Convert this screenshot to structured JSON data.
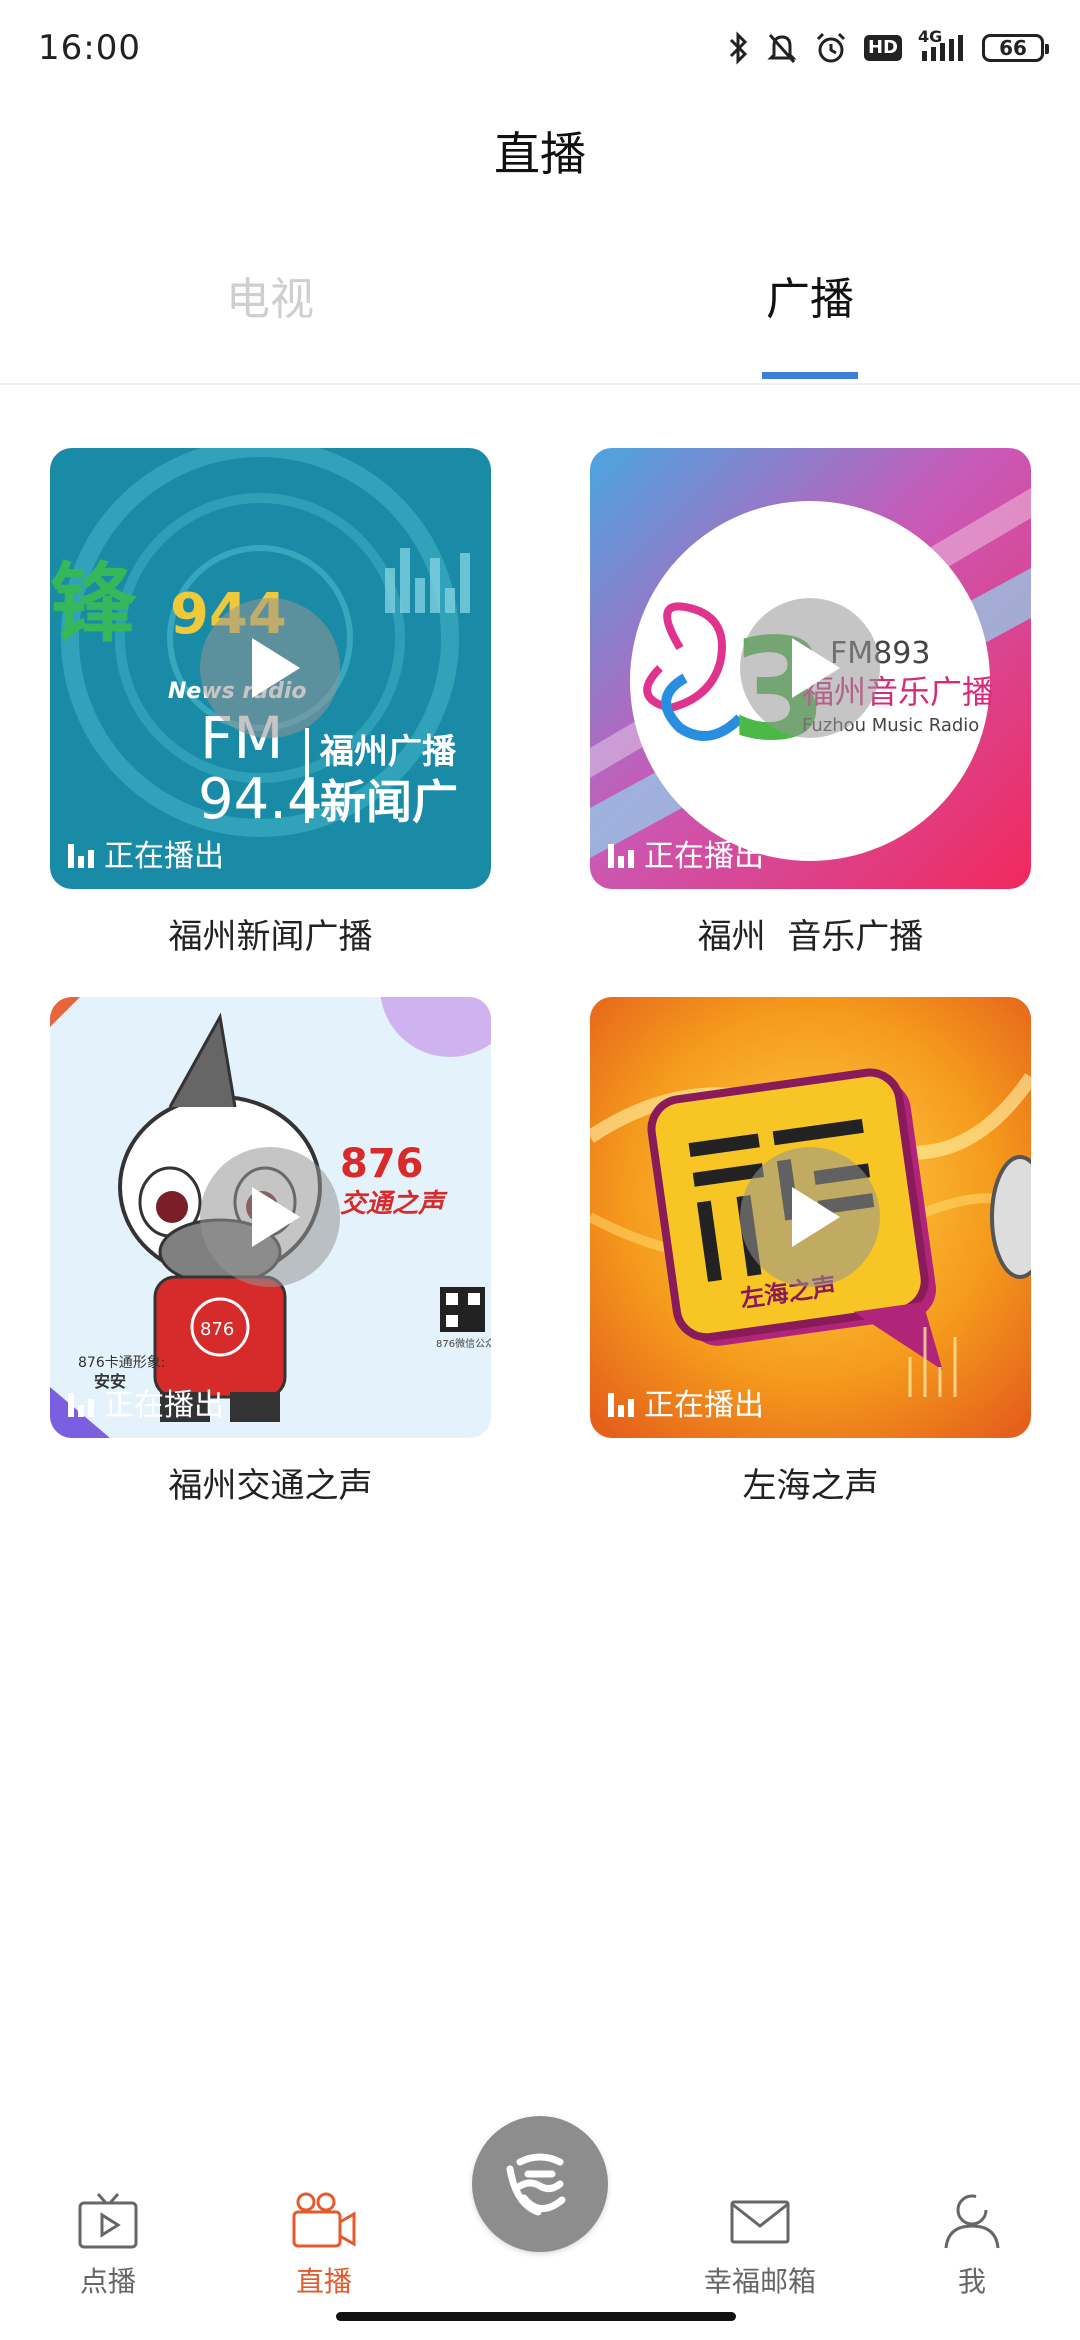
{
  "status_bar": {
    "time": "16:00",
    "network": "4G",
    "hd_label": "HD",
    "battery": "66"
  },
  "page": {
    "title": "直播"
  },
  "tabs": [
    {
      "label": "电视",
      "active": false
    },
    {
      "label": "广播",
      "active": true
    }
  ],
  "live_label": "正在播出",
  "stations": [
    {
      "title": "福州新闻广播",
      "art_text": {
        "brand": "News radio",
        "freq_band": "FM",
        "freq_num": "94.4",
        "name_top": "福州广播",
        "name_bottom": "新闻广"
      },
      "colors": {
        "bg": "#1d8fa6",
        "accent": "#33b85f"
      }
    },
    {
      "title": "福州  音乐广播",
      "art_text": {
        "freq": "FM893",
        "name": "福州音乐广播",
        "sub": "Fuzhou Music Radio"
      },
      "colors": {
        "bg": "#e84a85",
        "accent": "#7dd3e8"
      }
    },
    {
      "title": "福州交通之声",
      "art_text": {
        "logo_num": "876",
        "logo_name": "交通之声",
        "mascot_caption": "876卡通形象:",
        "mascot_name": "安安",
        "qr_caption": "876微信公众"
      },
      "colors": {
        "bg": "#e3f2fb",
        "accent": "#d72b2b"
      }
    },
    {
      "title": "左海之声",
      "art_text": {
        "logo_name": "左海之声"
      },
      "colors": {
        "bg": "#f29a1e",
        "accent": "#b2247a"
      }
    }
  ],
  "bottom_nav": [
    {
      "label": "点播",
      "icon": "tv-play-icon",
      "active": false
    },
    {
      "label": "直播",
      "icon": "video-camera-icon",
      "active": true
    },
    {
      "label": "",
      "icon": "center-logo-icon",
      "active": false
    },
    {
      "label": "幸福邮箱",
      "icon": "mail-icon",
      "active": false
    },
    {
      "label": "我",
      "icon": "user-icon",
      "active": false
    }
  ]
}
